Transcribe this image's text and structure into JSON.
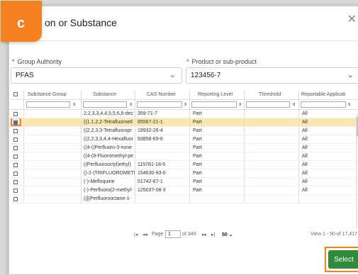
{
  "dialog": {
    "title": "on or Substance",
    "close_label": "✕"
  },
  "badge": {
    "letter": "c"
  },
  "group_authority": {
    "label": "Group Authority",
    "required": "*",
    "value": "PFAS"
  },
  "product": {
    "label": "Product or sub-product",
    "required": "*",
    "value": "123456-7"
  },
  "grid": {
    "columns": [
      "Substance Group",
      "Substance",
      "CAS Number",
      "Reporting Level",
      "Threshold",
      "Reportable Applicati"
    ],
    "filter_clear": "x",
    "rows": [
      {
        "checked": false,
        "group": "",
        "substance": "2,2,3,3,4,4,5,5,6,6-dec",
        "cas": "359-71-7",
        "level": "Part",
        "threshold": "",
        "app": "All"
      },
      {
        "checked": true,
        "group": "",
        "substance": "((1,1,2,2-Tetrafluoroetl",
        "cas": "85567-21-1",
        "level": "Part",
        "threshold": "",
        "app": "All"
      },
      {
        "checked": false,
        "group": "",
        "substance": "((2,2,3,3-Tetrafluoropr",
        "cas": "19932-26-4",
        "level": "Part",
        "threshold": "",
        "app": "All"
      },
      {
        "checked": false,
        "group": "",
        "substance": "((2,2,3,3,4,4-Hexafluor",
        "cas": "93858-69-6",
        "level": "Part",
        "threshold": "",
        "app": "All"
      },
      {
        "checked": false,
        "group": "",
        "substance": "((4-((Perfluoro-3-none",
        "cas": "",
        "level": "Part",
        "threshold": "",
        "app": "All"
      },
      {
        "checked": false,
        "group": "",
        "substance": "((4-(8-Fluoromethyl-pe",
        "cas": "",
        "level": "Part",
        "threshold": "",
        "app": "All"
      },
      {
        "checked": false,
        "group": "",
        "substance": "((Perfluorooctyl)ethyl)",
        "cas": "115781-18-5",
        "level": "Part",
        "threshold": "",
        "app": "All"
      },
      {
        "checked": false,
        "group": "",
        "substance": "()-2-(TRIFLUOROMETI",
        "cas": "154630-93-0",
        "level": "Part",
        "threshold": "",
        "app": "All"
      },
      {
        "checked": false,
        "group": "",
        "substance": "(-)-Mefloquine",
        "cas": "51742-87-1",
        "level": "Part",
        "threshold": "",
        "app": "All"
      },
      {
        "checked": false,
        "group": "",
        "substance": "(-)-Perfluoro(2-methyl-",
        "cas": "125037-08-3",
        "level": "Part",
        "threshold": "",
        "app": "All"
      },
      {
        "checked": false,
        "group": "",
        "substance": "(([(Perfluorooctane-1-",
        "cas": "",
        "level": "",
        "threshold": "",
        "app": ""
      }
    ]
  },
  "pager": {
    "first": "|◂",
    "prev": "◂◂",
    "page_label": "Page",
    "page_value": "1",
    "of_total": "of 349",
    "next": "▸▸",
    "last": "▸|",
    "page_size": "50",
    "summary": "View 1 - 50 of 17,417"
  },
  "footer": {
    "select_label": "Select"
  }
}
